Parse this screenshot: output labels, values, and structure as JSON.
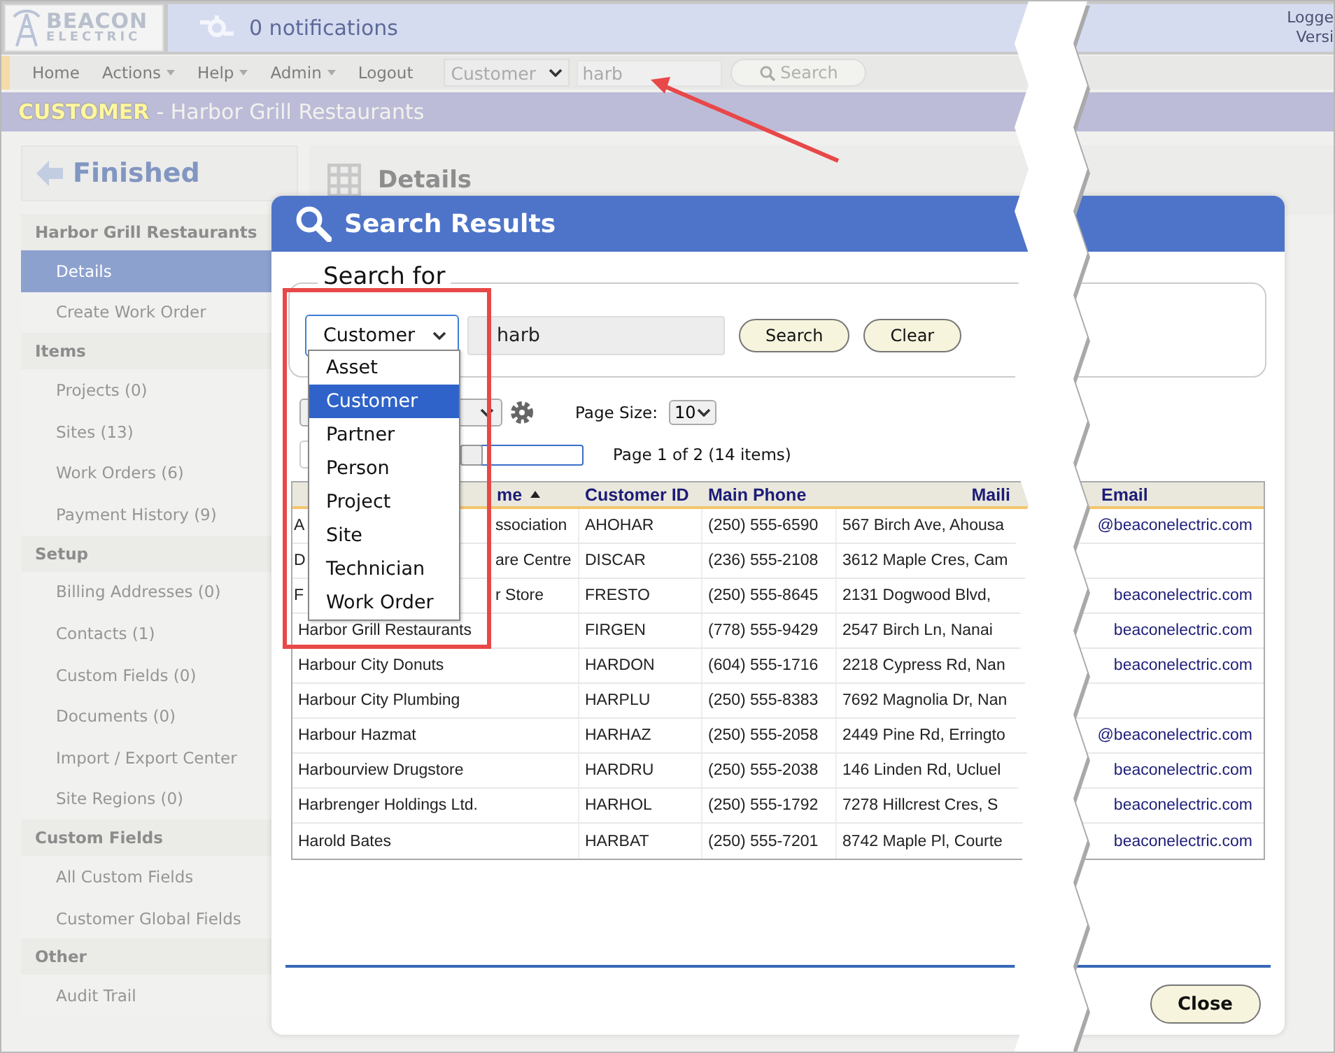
{
  "header": {
    "logo": {
      "line1": "BEACON",
      "line2": "ELECTRIC"
    },
    "notifications": "0 notifications",
    "user_lines": [
      "Logge",
      "Versi"
    ]
  },
  "nav": {
    "items": [
      {
        "label": "Home",
        "dropdown": false
      },
      {
        "label": "Actions",
        "dropdown": true
      },
      {
        "label": "Help",
        "dropdown": true
      },
      {
        "label": "Admin",
        "dropdown": true
      },
      {
        "label": "Logout",
        "dropdown": false
      }
    ],
    "search": {
      "type": "Customer",
      "query": "harb",
      "button": "Search"
    }
  },
  "title_bar": {
    "entity": "CUSTOMER",
    "name": "- Harbor Grill Restaurants"
  },
  "sidebar": {
    "back_button": "Finished",
    "sections": [
      {
        "title": "Harbor Grill Restaurants",
        "items": [
          {
            "label": "Details",
            "selected": true
          },
          {
            "label": "Create Work Order",
            "selected": false
          }
        ]
      },
      {
        "title": "Items",
        "items": [
          {
            "label": "Projects (0)",
            "selected": false
          },
          {
            "label": "Sites (13)",
            "selected": false
          },
          {
            "label": "Work Orders (6)",
            "selected": false
          },
          {
            "label": "Payment History (9)",
            "selected": false
          }
        ]
      },
      {
        "title": "Setup",
        "items": [
          {
            "label": "Billing Addresses (0)",
            "selected": false
          },
          {
            "label": "Contacts (1)",
            "selected": false
          },
          {
            "label": "Custom Fields (0)",
            "selected": false
          },
          {
            "label": "Documents (0)",
            "selected": false
          },
          {
            "label": "Import / Export Center",
            "selected": false
          },
          {
            "label": "Site Regions (0)",
            "selected": false
          }
        ]
      },
      {
        "title": "Custom Fields",
        "items": [
          {
            "label": "All Custom Fields",
            "selected": false
          },
          {
            "label": "Customer Global Fields",
            "selected": false
          }
        ]
      },
      {
        "title": "Other",
        "items": [
          {
            "label": "Audit Trail",
            "selected": false
          }
        ]
      }
    ]
  },
  "main": {
    "heading": "Details"
  },
  "modal": {
    "title": "Search Results",
    "search_for": {
      "legend": "Search for",
      "type": "Customer",
      "query": "harb",
      "buttons": [
        "Search",
        "Clear"
      ],
      "type_options": [
        {
          "label": "Asset",
          "selected": false
        },
        {
          "label": "Customer",
          "selected": true
        },
        {
          "label": "Partner",
          "selected": false
        },
        {
          "label": "Person",
          "selected": false
        },
        {
          "label": "Project",
          "selected": false
        },
        {
          "label": "Site",
          "selected": false
        },
        {
          "label": "Technician",
          "selected": false
        },
        {
          "label": "Work Order",
          "selected": false
        }
      ]
    },
    "pager_slider": {
      "level": 0
    },
    "page_size_label": "Page Size:",
    "page_size": "10",
    "pager_text": "Page 1 of 2 (14 items)",
    "table": {
      "columns": [
        "me",
        "Customer ID",
        "Main Phone",
        "Maili",
        "Email"
      ],
      "rows": [
        {
          "name_parts": [
            "A",
            "ssociation"
          ],
          "id": "AHOHAR",
          "phone": "(250) 555-6590",
          "address": "567 Birch Ave, Ahousa",
          "email": "@beaconelectric.com"
        },
        {
          "name_parts": [
            "D",
            "are Centre"
          ],
          "id": "DISCAR",
          "phone": "(236) 555-2108",
          "address": "3612 Maple Cres, Cam",
          "email": ""
        },
        {
          "name_parts": [
            "F",
            "r Store"
          ],
          "id": "FRESTO",
          "phone": "(250) 555-8645",
          "address": "2131 Dogwood Blvd,",
          "email": "beaconelectric.com"
        },
        {
          "name": "Harbor Grill Restaurants",
          "id": "FIRGEN",
          "phone": "(778) 555-9429",
          "address": "2547 Birch Ln, Nanai",
          "email": "beaconelectric.com"
        },
        {
          "name": "Harbour City Donuts",
          "id": "HARDON",
          "phone": "(604) 555-1716",
          "address": "2218 Cypress Rd, Nan",
          "email": "beaconelectric.com"
        },
        {
          "name": "Harbour City Plumbing",
          "id": "HARPLU",
          "phone": "(250) 555-8383",
          "address": "7692 Magnolia Dr, Nan",
          "email": ""
        },
        {
          "name": "Harbour Hazmat",
          "id": "HARHAZ",
          "phone": "(250) 555-2058",
          "address": "2449 Pine Rd, Erringto",
          "email": "@beaconelectric.com"
        },
        {
          "name": "Harbourview Drugstore",
          "id": "HARDRU",
          "phone": "(250) 555-2038",
          "address": "146 Linden Rd, Ucluel",
          "email": "beaconelectric.com"
        },
        {
          "name": "Harbrenger Holdings Ltd.",
          "id": "HARHOL",
          "phone": "(250) 555-1792",
          "address": "7278 Hillcrest Cres, S",
          "email": "beaconelectric.com"
        },
        {
          "name": "Harold Bates",
          "id": "HARBAT",
          "phone": "(250) 555-7201",
          "address": "8742 Maple Pl, Courte",
          "email": "beaconelectric.com"
        }
      ]
    },
    "close_button": "Close"
  }
}
